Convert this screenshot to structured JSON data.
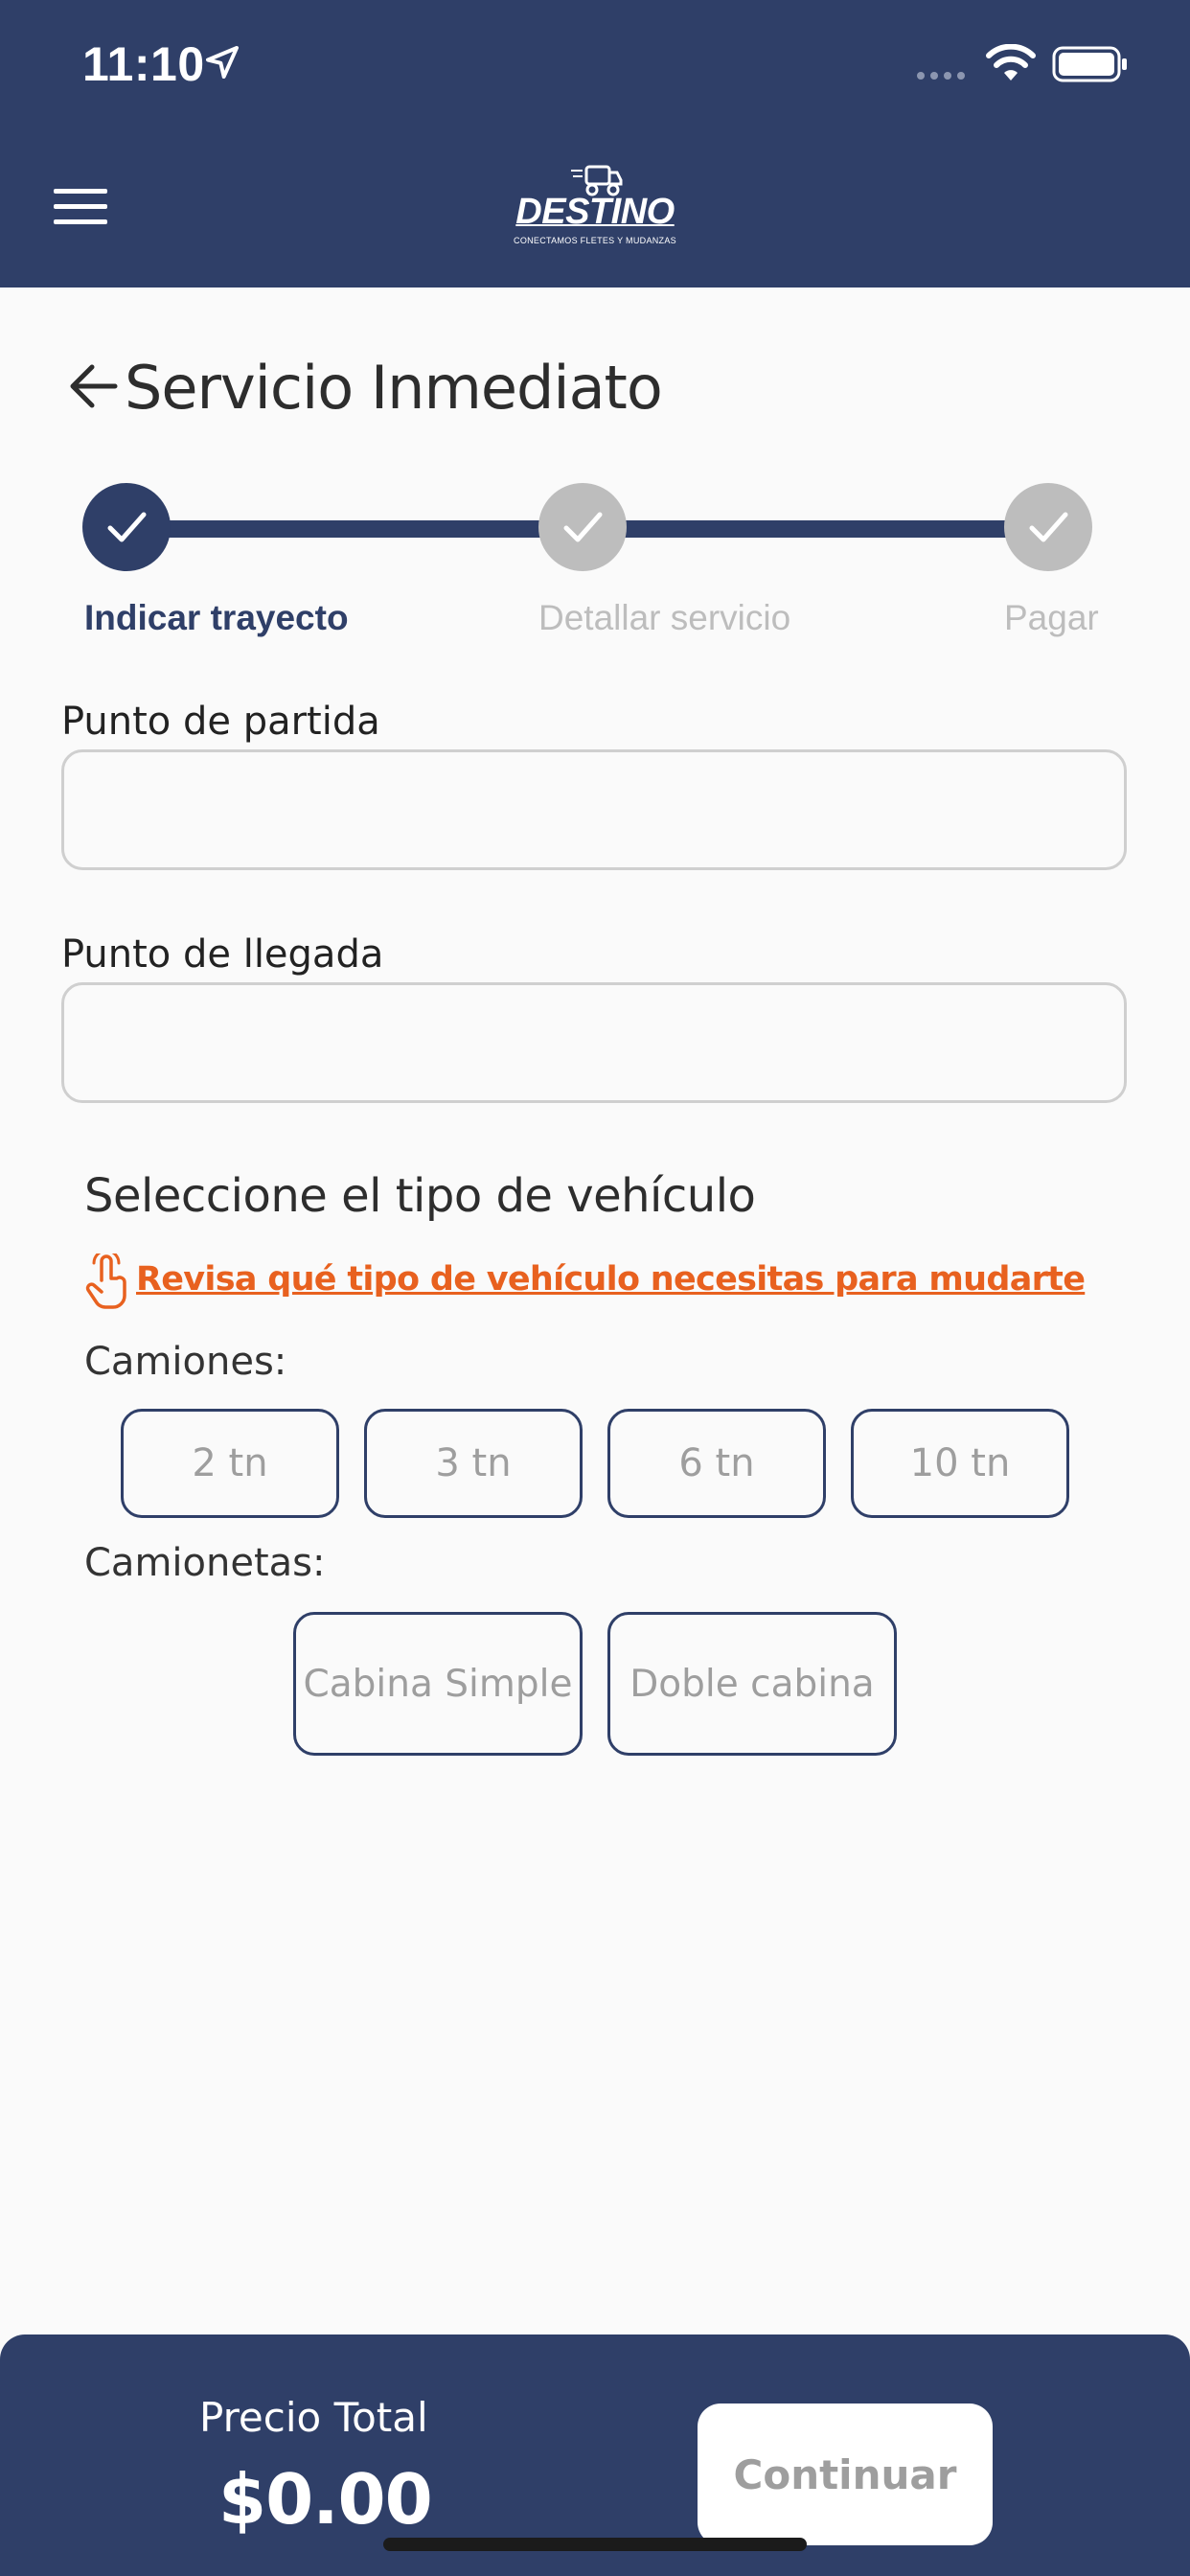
{
  "status_bar": {
    "time": "11:10"
  },
  "header": {
    "logo_text": "DESTINO",
    "logo_tagline": "CONECTAMOS FLETES Y MUDANZAS"
  },
  "page": {
    "title": "Servicio Inmediato"
  },
  "stepper": {
    "steps": [
      {
        "label": "Indicar trayecto",
        "state": "active"
      },
      {
        "label": "Detallar servicio",
        "state": "inactive"
      },
      {
        "label": "Pagar",
        "state": "inactive"
      }
    ]
  },
  "form": {
    "origin_label": "Punto de partida",
    "origin_value": "",
    "destination_label": "Punto de llegada",
    "destination_value": ""
  },
  "vehicle": {
    "section_title": "Seleccione el tipo de vehículo",
    "hint_link": "Revisa qué tipo de vehículo necesitas para mudarte",
    "trucks_label": "Camiones:",
    "trucks": [
      "2 tn",
      "3 tn",
      "6 tn",
      "10 tn"
    ],
    "pickups_label": "Camionetas:",
    "pickups": [
      "Cabina Simple",
      "Doble cabina"
    ]
  },
  "footer": {
    "price_label": "Precio Total",
    "price_value": "$0.00",
    "continue_label": "Continuar"
  },
  "colors": {
    "primary": "#2f3f68",
    "accent": "#e8611f",
    "inactive": "#bdbdbd",
    "background": "#fafafa"
  }
}
